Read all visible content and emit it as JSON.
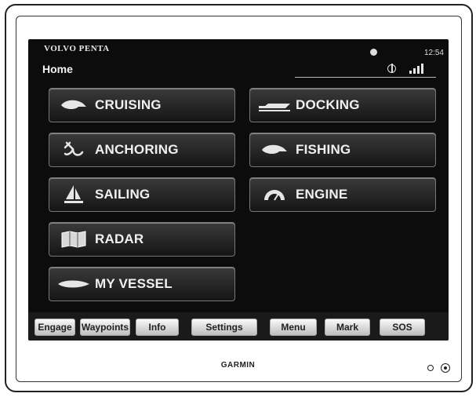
{
  "header": {
    "brand": "VOLVO PENTA",
    "title": "Home",
    "time": "12:54"
  },
  "tiles": [
    {
      "label": "CRUISING",
      "icon": "boat-cruising-icon"
    },
    {
      "label": "DOCKING",
      "icon": "dock-icon"
    },
    {
      "label": "ANCHORING",
      "icon": "anchor-icon"
    },
    {
      "label": "FISHING",
      "icon": "fishing-boat-icon"
    },
    {
      "label": "SAILING",
      "icon": "sailboat-icon"
    },
    {
      "label": "ENGINE",
      "icon": "engine-icon"
    },
    {
      "label": "RADAR",
      "icon": "map-icon"
    },
    {
      "label": "MY VESSEL",
      "icon": "vessel-icon"
    }
  ],
  "bottom_bar": {
    "buttons": [
      "Engage",
      "Waypoints",
      "Info",
      "Settings",
      "Menu",
      "Mark",
      "SOS"
    ]
  },
  "device": {
    "brand": "GARMIN"
  },
  "colors": {
    "screen_background": "#0c0c0c",
    "tile_border": "#777777",
    "button_face": "#e0e0e0"
  }
}
